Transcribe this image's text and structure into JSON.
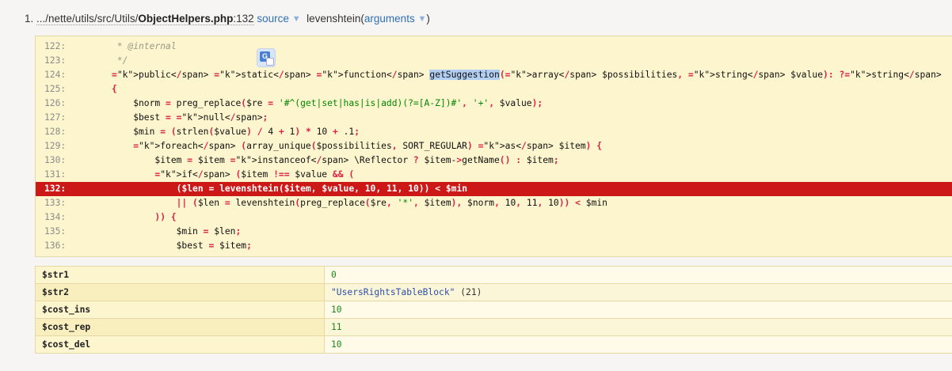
{
  "frame": {
    "number": "1.",
    "path": ".../nette/utils/src/Utils/",
    "file": "ObjectHelpers.php",
    "line_suffix": ":132",
    "source_label": "source",
    "function": "levenshtein(",
    "arguments_label": "arguments",
    "close_paren": ")"
  },
  "code": {
    "lines": [
      {
        "no": "122:",
        "text": "         * @internal"
      },
      {
        "no": "123:",
        "text": "         */"
      },
      {
        "no": "124:",
        "text": "        public static function getSuggestion(array $possibilities, string $value): ?string"
      },
      {
        "no": "125:",
        "text": "        {"
      },
      {
        "no": "126:",
        "text": "            $norm = preg_replace($re = '#^(get|set|has|is|add)(?=[A-Z])#', '+', $value);"
      },
      {
        "no": "127:",
        "text": "            $best = null;"
      },
      {
        "no": "128:",
        "text": "            $min = (strlen($value) / 4 + 1) * 10 + .1;"
      },
      {
        "no": "129:",
        "text": "            foreach (array_unique($possibilities, SORT_REGULAR) as $item) {"
      },
      {
        "no": "130:",
        "text": "                $item = $item instanceof \\Reflector ? $item->getName() : $item;"
      },
      {
        "no": "131:",
        "text": "                if ($item !== $value && ("
      },
      {
        "no": "132:",
        "text": "                    ($len = levenshtein($item, $value, 10, 11, 10)) < $min"
      },
      {
        "no": "133:",
        "text": "                    || ($len = levenshtein(preg_replace($re, '*', $item), $norm, 10, 11, 10)) < $min"
      },
      {
        "no": "134:",
        "text": "                )) {"
      },
      {
        "no": "135:",
        "text": "                    $min = $len;"
      },
      {
        "no": "136:",
        "text": "                    $best = $item;"
      }
    ],
    "highlighted_line": "132:",
    "selected_word": "getSuggestion",
    "translate_icon": "google-translate-icon"
  },
  "variables": [
    {
      "name": "$str1",
      "value": "0",
      "kind": "number"
    },
    {
      "name": "$str2",
      "value": "\"UsersRightsTableBlock\"",
      "kind": "string",
      "length": "(21)"
    },
    {
      "name": "$cost_ins",
      "value": "10",
      "kind": "number"
    },
    {
      "name": "$cost_rep",
      "value": "11",
      "kind": "number"
    },
    {
      "name": "$cost_del",
      "value": "10",
      "kind": "number"
    }
  ]
}
